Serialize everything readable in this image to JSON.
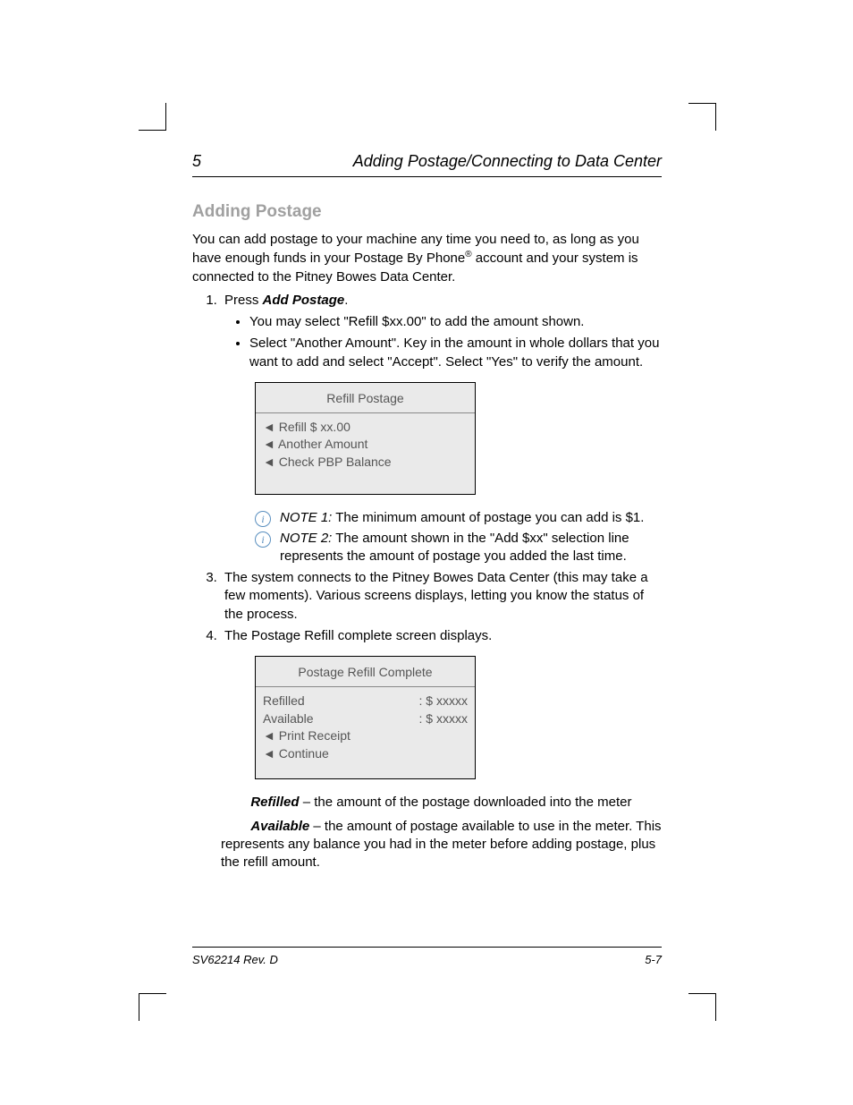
{
  "header": {
    "chapter_num": "5",
    "chapter_title": "Adding Postage/Connecting to Data Center"
  },
  "section_title": "Adding Postage",
  "intro_1": "You can add postage to your machine any time you need to, as long as you have enough funds in your Postage By Phone",
  "intro_2": " account and your system is connected to the Pitney Bowes Data Center.",
  "step1": {
    "prefix": "Press ",
    "button": "Add Postage",
    "suffix": ".",
    "bullet1": "You may select \"Refill $xx.00\" to add the amount shown.",
    "bullet2": "Select \"Another Amount\". Key in the amount in whole dollars that you want to add and select \"Accept\". Select \"Yes\" to verify the amount."
  },
  "screen1": {
    "title": "Refill Postage",
    "opt1": "◄ Refill  $ xx.00",
    "opt2": "◄ Another Amount",
    "opt3": "◄ Check PBP Balance"
  },
  "note1": {
    "label": "NOTE 1:",
    "text": " The minimum amount of postage you can add is $1."
  },
  "note2": {
    "label": "NOTE 2:",
    "text": " The amount shown in the \"Add $xx\" selection line represents the amount of postage you added the last time."
  },
  "step3": "The system connects to the Pitney Bowes Data Center (this may take a few moments). Various screens displays, letting you know the status of the process.",
  "step4": "The Postage Refill complete screen displays.",
  "screen2": {
    "title": "Postage Refill Complete",
    "row1_label": "Refilled",
    "row1_val": ":  $ xxxxx",
    "row2_label": "Available",
    "row2_val": ":  $ xxxxx",
    "opt1": "◄ Print Receipt",
    "opt2": "◄ Continue"
  },
  "def1": {
    "term": "Refilled",
    "text": " – the amount of the postage downloaded into the meter"
  },
  "def2": {
    "term": "Available",
    "text": " – the amount of postage available to use in the meter. This represents any balance you had in the meter before adding postage, plus the refill amount."
  },
  "footer": {
    "left": "SV62214 Rev. D",
    "right": "5-7"
  }
}
